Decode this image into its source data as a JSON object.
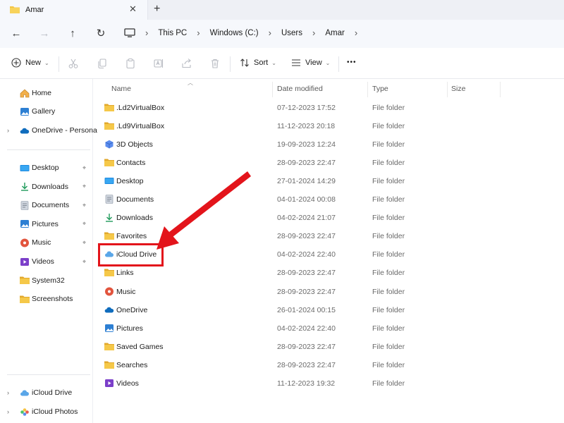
{
  "tab": {
    "title": "Amar",
    "close_glyph": "✕",
    "new_glyph": "+"
  },
  "nav": {
    "back": "←",
    "forward": "→",
    "up": "↑",
    "refresh": "↻"
  },
  "breadcrumb": [
    "This PC",
    "Windows (C:)",
    "Users",
    "Amar"
  ],
  "breadcrumb_sep": "›",
  "toolbar": {
    "new_label": "New",
    "sort_label": "Sort",
    "view_label": "View",
    "more_label": "•••",
    "dropdown_glyph": "⌄"
  },
  "sidebar": {
    "top": [
      {
        "label": "Home",
        "icon": "home-icon"
      },
      {
        "label": "Gallery",
        "icon": "gallery-icon"
      },
      {
        "label": "OneDrive - Persona",
        "icon": "onedrive-icon",
        "expandable": true
      }
    ],
    "quick": [
      {
        "label": "Desktop",
        "icon": "desktop-icon",
        "pinned": true
      },
      {
        "label": "Downloads",
        "icon": "downloads-icon",
        "pinned": true
      },
      {
        "label": "Documents",
        "icon": "documents-icon",
        "pinned": true
      },
      {
        "label": "Pictures",
        "icon": "pictures-icon",
        "pinned": true
      },
      {
        "label": "Music",
        "icon": "music-icon",
        "pinned": true
      },
      {
        "label": "Videos",
        "icon": "videos-icon",
        "pinned": true
      },
      {
        "label": "System32",
        "icon": "folder-icon",
        "pinned": false
      },
      {
        "label": "Screenshots",
        "icon": "folder-icon",
        "pinned": false
      }
    ],
    "bottom": [
      {
        "label": "iCloud Drive",
        "icon": "icloud-icon"
      },
      {
        "label": "iCloud Photos",
        "icon": "icloud-photos-icon"
      }
    ],
    "pin_glyph": "📌",
    "expand_glyph": "›"
  },
  "columns": {
    "name": "Name",
    "date": "Date modified",
    "type": "Type",
    "size": "Size"
  },
  "files": [
    {
      "name": ".Ld2VirtualBox",
      "date": "07-12-2023 17:52",
      "type": "File folder",
      "icon": "folder"
    },
    {
      "name": ".Ld9VirtualBox",
      "date": "11-12-2023 20:18",
      "type": "File folder",
      "icon": "folder"
    },
    {
      "name": "3D Objects",
      "date": "19-09-2023 12:24",
      "type": "File folder",
      "icon": "3d"
    },
    {
      "name": "Contacts",
      "date": "28-09-2023 22:47",
      "type": "File folder",
      "icon": "folder"
    },
    {
      "name": "Desktop",
      "date": "27-01-2024 14:29",
      "type": "File folder",
      "icon": "desktop"
    },
    {
      "name": "Documents",
      "date": "04-01-2024 00:08",
      "type": "File folder",
      "icon": "documents"
    },
    {
      "name": "Downloads",
      "date": "04-02-2024 21:07",
      "type": "File folder",
      "icon": "downloads"
    },
    {
      "name": "Favorites",
      "date": "28-09-2023 22:47",
      "type": "File folder",
      "icon": "folder"
    },
    {
      "name": "iCloud Drive",
      "date": "04-02-2024 22:40",
      "type": "File folder",
      "icon": "icloud"
    },
    {
      "name": "Links",
      "date": "28-09-2023 22:47",
      "type": "File folder",
      "icon": "folder"
    },
    {
      "name": "Music",
      "date": "28-09-2023 22:47",
      "type": "File folder",
      "icon": "music"
    },
    {
      "name": "OneDrive",
      "date": "26-01-2024 00:15",
      "type": "File folder",
      "icon": "onedrive"
    },
    {
      "name": "Pictures",
      "date": "04-02-2024 22:40",
      "type": "File folder",
      "icon": "pictures"
    },
    {
      "name": "Saved Games",
      "date": "28-09-2023 22:47",
      "type": "File folder",
      "icon": "folder"
    },
    {
      "name": "Searches",
      "date": "28-09-2023 22:47",
      "type": "File folder",
      "icon": "folder"
    },
    {
      "name": "Videos",
      "date": "11-12-2023 19:32",
      "type": "File folder",
      "icon": "videos"
    }
  ],
  "annotation": {
    "highlighted_item": "iCloud Drive",
    "color": "#e3141b"
  },
  "colors": {
    "folder": "#f4c542",
    "accent": "#0f6cbd",
    "highlight": "#e3141b"
  }
}
